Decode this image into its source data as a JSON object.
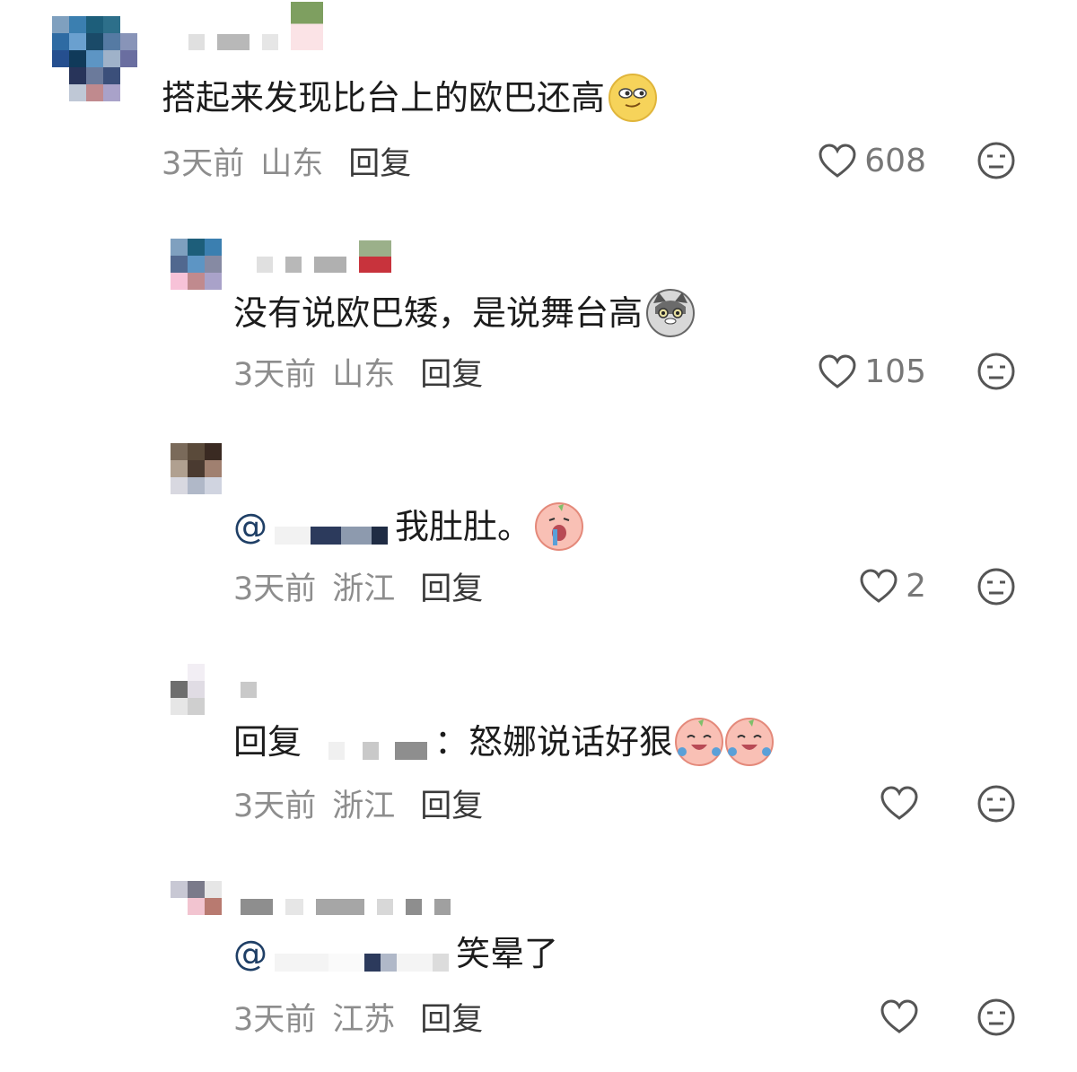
{
  "comments": [
    {
      "text": "搭起来发现比台上的欧巴还高",
      "emoji": "smirk-emoji",
      "time": "3天前",
      "location": "山东",
      "reply": "回复",
      "likes": "608"
    },
    {
      "text": "没有说欧巴矮，是说舞台高",
      "emoji": "cat-emoji",
      "time": "3天前",
      "location": "山东",
      "reply": "回复",
      "likes": "105"
    },
    {
      "mention_prefix": "@",
      "text": "我肚肚。",
      "emoji": "crying-peach-emoji",
      "time": "3天前",
      "location": "浙江",
      "reply": "回复",
      "likes": "2"
    },
    {
      "reply_prefix": "回复",
      "text": "：怒娜说话好狠",
      "emoji": "laugh-cry-peach-emoji",
      "time": "3天前",
      "location": "浙江",
      "reply": "回复",
      "likes": ""
    },
    {
      "mention_prefix": "@",
      "text": "笑晕了",
      "time": "3天前",
      "location": "江苏",
      "reply": "回复",
      "likes": ""
    }
  ],
  "colors": {
    "text": "#1c1c1c",
    "meta": "#8d8d8d",
    "mention": "#1f3f66"
  }
}
